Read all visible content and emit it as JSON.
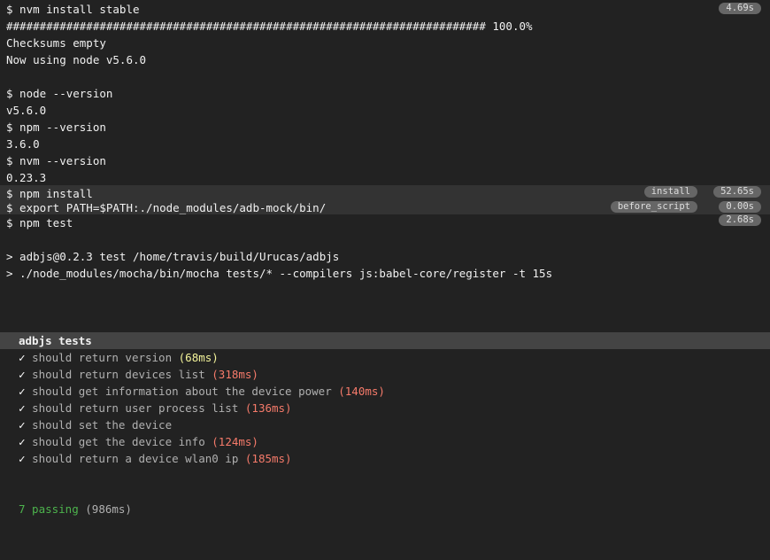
{
  "header": {
    "line1": "$ nvm install stable",
    "line1_time": "4.69s"
  },
  "lines": {
    "progress": "######################################################################## 100.0%",
    "checksums": "Checksums empty",
    "now_using": "Now using node v5.6.0",
    "node_cmd": "$ node --version",
    "node_ver": "v5.6.0",
    "npm_cmd": "$ npm --version",
    "npm_ver": "3.6.0",
    "nvm_cmd": "$ nvm --version",
    "nvm_ver": "0.23.3",
    "npm_install": "$ npm install",
    "npm_install_tag": "install",
    "npm_install_time": "52.65s",
    "export_cmd": "$ export PATH=$PATH:./node_modules/adb-mock/bin/",
    "export_tag": "before_script",
    "export_time": "0.00s",
    "npm_test": "$ npm test",
    "npm_test_time": "2.68s",
    "script1": "> adbjs@0.2.3 test /home/travis/build/Urucas/adbjs",
    "script2": "> ./node_modules/mocha/bin/mocha tests/* --compilers js:babel-core/register -t 15s"
  },
  "suite": {
    "title": "adbjs tests",
    "tests": [
      {
        "check": "✓",
        "name": "should return version",
        "dur": "(68ms)"
      },
      {
        "check": "✓",
        "name": "should return devices list",
        "dur": "(318ms)"
      },
      {
        "check": "✓",
        "name": "should get information about the device power",
        "dur": "(140ms)"
      },
      {
        "check": "✓",
        "name": "should return user process list",
        "dur": "(136ms)"
      },
      {
        "check": "✓",
        "name": "should set the device",
        "dur": ""
      },
      {
        "check": "✓",
        "name": "should get the device info",
        "dur": "(124ms)"
      },
      {
        "check": "✓",
        "name": "should return a device wlan0 ip",
        "dur": "(185ms)"
      }
    ]
  },
  "summary": {
    "passing": "7 passing",
    "total": "(986ms)"
  },
  "colors": {
    "background": "#222222",
    "slow": "#f57a6a",
    "medium": "#f3f39a",
    "pass": "#4db34d"
  }
}
